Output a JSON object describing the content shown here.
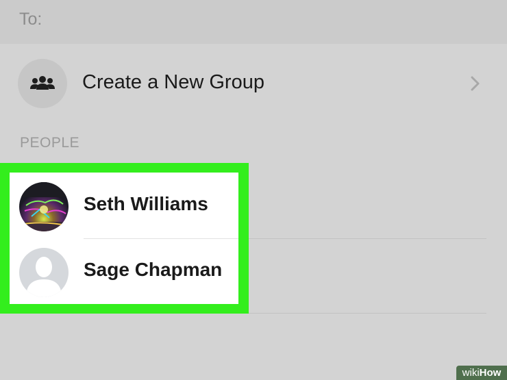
{
  "to_field": {
    "label": "To:"
  },
  "create_group": {
    "label": "Create a New Group",
    "icon": "group-icon"
  },
  "people_section": {
    "header": "PEOPLE",
    "contacts": [
      {
        "name": "Seth Williams",
        "avatar": "photo-avatar"
      },
      {
        "name": "Sage Chapman",
        "avatar": "default-avatar"
      }
    ]
  },
  "watermark": {
    "wiki": "wiki",
    "how": "How"
  },
  "colors": {
    "highlight": "#33ee1d",
    "background": "#d3d3d3",
    "to_bar": "#cbcbcb"
  }
}
